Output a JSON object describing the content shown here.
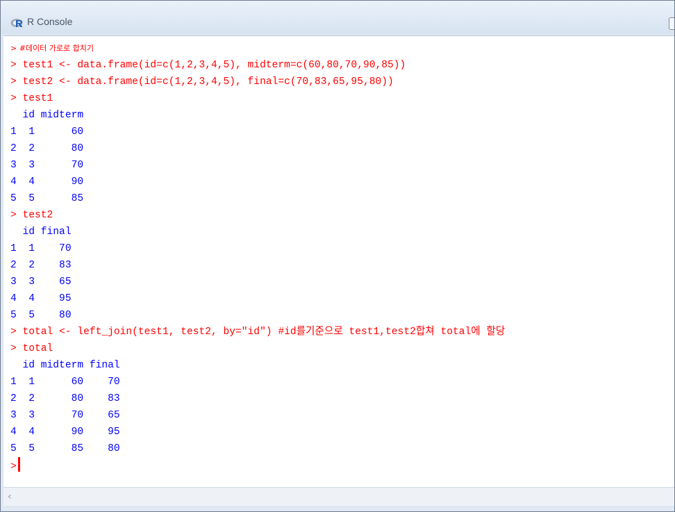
{
  "window": {
    "title": "R Console"
  },
  "console": {
    "prompt": ">",
    "lines": [
      {
        "kind": "input",
        "text": "> #데이터 가로로 합치기"
      },
      {
        "kind": "input",
        "text": "> test1 <- data.frame(id=c(1,2,3,4,5), midterm=c(60,80,70,90,85))"
      },
      {
        "kind": "input",
        "text": "> test2 <- data.frame(id=c(1,2,3,4,5), final=c(70,83,65,95,80))"
      },
      {
        "kind": "input",
        "text": "> test1"
      },
      {
        "kind": "output",
        "text": "  id midterm"
      },
      {
        "kind": "output",
        "text": "1  1      60"
      },
      {
        "kind": "output",
        "text": "2  2      80"
      },
      {
        "kind": "output",
        "text": "3  3      70"
      },
      {
        "kind": "output",
        "text": "4  4      90"
      },
      {
        "kind": "output",
        "text": "5  5      85"
      },
      {
        "kind": "input",
        "text": "> test2"
      },
      {
        "kind": "output",
        "text": "  id final"
      },
      {
        "kind": "output",
        "text": "1  1    70"
      },
      {
        "kind": "output",
        "text": "2  2    83"
      },
      {
        "kind": "output",
        "text": "3  3    65"
      },
      {
        "kind": "output",
        "text": "4  4    95"
      },
      {
        "kind": "output",
        "text": "5  5    80"
      },
      {
        "kind": "input",
        "text": "> total <- left_join(test1, test2, by=\"id\") #id를기준으로 test1,test2합쳐 total에 할당"
      },
      {
        "kind": "input",
        "text": "> total"
      },
      {
        "kind": "output",
        "text": "  id midterm final"
      },
      {
        "kind": "output",
        "text": "1  1      60    70"
      },
      {
        "kind": "output",
        "text": "2  2      80    83"
      },
      {
        "kind": "output",
        "text": "3  3      70    65"
      },
      {
        "kind": "output",
        "text": "4  4      90    95"
      },
      {
        "kind": "output",
        "text": "5  5      85    80"
      }
    ]
  },
  "icons": {
    "app": "r-logo-icon",
    "scroll_left": "chevron-left-icon"
  },
  "colors": {
    "input": "#ff0000",
    "output": "#0000ff",
    "title_bar": "#dfe8f3"
  }
}
